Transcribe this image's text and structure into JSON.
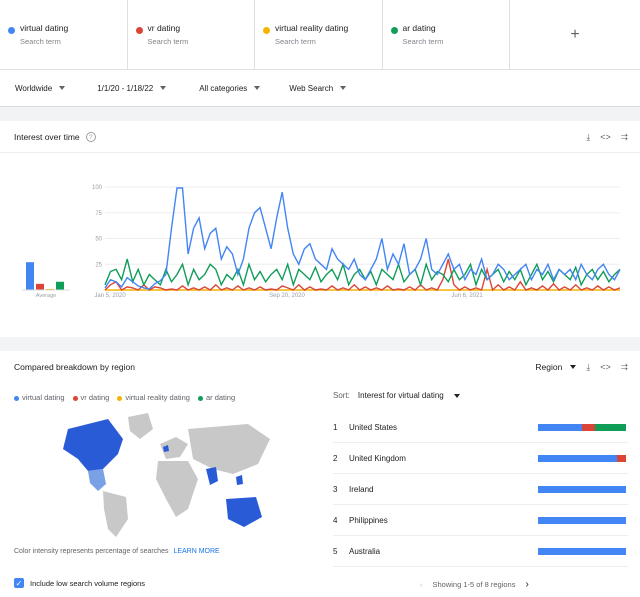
{
  "terms": [
    {
      "name": "virtual dating",
      "sub": "Search term",
      "color": "#4285f4"
    },
    {
      "name": "vr dating",
      "sub": "Search term",
      "color": "#db4437"
    },
    {
      "name": "virtual reality dating",
      "sub": "Search term",
      "color": "#f4b400"
    },
    {
      "name": "ar dating",
      "sub": "Search term",
      "color": "#0f9d58"
    }
  ],
  "add_icon": "+",
  "filters": {
    "region": "Worldwide",
    "dates": "1/1/20 - 1/18/22",
    "category": "All categories",
    "property": "Web Search"
  },
  "interest_card": {
    "title": "Interest over time",
    "help": "?",
    "icons": [
      "download-icon",
      "embed-icon",
      "share-icon"
    ]
  },
  "breakdown_card": {
    "title": "Compared breakdown by region",
    "region_select": "Region",
    "sort_label": "Sort:",
    "sort_value": "Interest for virtual dating",
    "note": "Color intensity represents percentage of searches",
    "learn_more": "LEARN MORE",
    "checkbox_label": "Include low search volume regions",
    "pagination": "Showing 1-5 of 8 regions"
  },
  "regions": [
    {
      "rank": "1",
      "name": "United States",
      "shares": [
        0.5,
        0.15,
        0.0,
        0.35
      ]
    },
    {
      "rank": "2",
      "name": "United Kingdom",
      "shares": [
        0.9,
        0.1,
        0.0,
        0.0
      ]
    },
    {
      "rank": "3",
      "name": "Ireland",
      "shares": [
        1.0,
        0.0,
        0.0,
        0.0
      ]
    },
    {
      "rank": "4",
      "name": "Philippines",
      "shares": [
        1.0,
        0.0,
        0.0,
        0.0
      ]
    },
    {
      "rank": "5",
      "name": "Australia",
      "shares": [
        1.0,
        0.0,
        0.0,
        0.0
      ]
    }
  ],
  "chart_data": {
    "type": "line",
    "yticks": [
      "100",
      "75",
      "50",
      "25"
    ],
    "ylim": [
      0,
      100
    ],
    "xtick_labels": [
      "Jan 5, 2020",
      "Sep 20, 2020",
      "Jun 6, 2021"
    ],
    "average_label": "Average",
    "averages": [
      27,
      6,
      1,
      8
    ],
    "colors": [
      "#4285f4",
      "#db4437",
      "#f4b400",
      "#0f9d58"
    ],
    "series": [
      {
        "name": "virtual dating",
        "values": [
          2,
          10,
          8,
          3,
          12,
          8,
          4,
          2,
          1,
          6,
          9,
          15,
          60,
          99,
          99,
          35,
          60,
          70,
          40,
          55,
          60,
          30,
          42,
          35,
          15,
          30,
          60,
          75,
          80,
          60,
          40,
          70,
          95,
          60,
          35,
          25,
          40,
          45,
          30,
          25,
          20,
          40,
          30,
          25,
          20,
          30,
          15,
          10,
          20,
          30,
          50,
          20,
          35,
          25,
          45,
          15,
          20,
          30,
          50,
          20,
          15,
          25,
          35,
          20,
          25,
          10,
          20,
          15,
          30,
          10,
          15,
          25,
          20,
          10,
          15,
          20,
          25,
          10,
          20,
          15,
          25,
          10,
          20,
          15,
          20,
          10,
          25,
          15,
          10,
          20,
          25,
          15,
          10,
          20
        ]
      },
      {
        "name": "vr dating",
        "values": [
          0,
          5,
          8,
          0,
          3,
          2,
          0,
          5,
          0,
          3,
          2,
          0,
          1,
          0,
          4,
          0,
          2,
          0,
          3,
          0,
          5,
          0,
          2,
          0,
          4,
          0,
          2,
          0,
          3,
          0,
          1,
          0,
          4,
          2,
          0,
          5,
          0,
          3,
          0,
          1,
          0,
          4,
          0,
          2,
          0,
          5,
          0,
          3,
          0,
          2,
          0,
          4,
          0,
          1,
          0,
          3,
          0,
          5,
          0,
          2,
          0,
          10,
          30,
          5,
          0,
          3,
          0,
          2,
          0,
          20,
          0,
          5,
          0,
          3,
          0,
          8,
          0,
          2,
          0,
          4,
          0,
          6,
          0,
          3,
          0,
          5,
          0,
          2,
          0,
          4,
          0,
          3,
          0,
          2
        ]
      },
      {
        "name": "virtual reality dating",
        "values": [
          0,
          0,
          0,
          0,
          0,
          0,
          0,
          0,
          0,
          0,
          0,
          0,
          0,
          0,
          0,
          0,
          0,
          0,
          0,
          0,
          0,
          0,
          0,
          0,
          0,
          0,
          0,
          0,
          0,
          0,
          0,
          0,
          0,
          0,
          0,
          0,
          0,
          0,
          0,
          0,
          0,
          0,
          0,
          0,
          0,
          0,
          0,
          0,
          0,
          0,
          0,
          0,
          0,
          0,
          0,
          0,
          0,
          0,
          0,
          0,
          0,
          0,
          0,
          0,
          0,
          0,
          0,
          0,
          0,
          0,
          0,
          0,
          0,
          0,
          0,
          0,
          0,
          0,
          0,
          0,
          0,
          0,
          0,
          0,
          0,
          0,
          0,
          0,
          0,
          0,
          0,
          0,
          0,
          0
        ]
      },
      {
        "name": "ar dating",
        "values": [
          5,
          18,
          20,
          10,
          30,
          8,
          20,
          5,
          15,
          10,
          5,
          20,
          8,
          15,
          25,
          5,
          20,
          10,
          15,
          25,
          20,
          5,
          15,
          10,
          20,
          5,
          25,
          10,
          18,
          8,
          15,
          20,
          10,
          25,
          5,
          20,
          15,
          10,
          22,
          8,
          15,
          20,
          10,
          25,
          5,
          15,
          20,
          10,
          18,
          5,
          20,
          15,
          10,
          25,
          8,
          15,
          20,
          5,
          25,
          10,
          18,
          15,
          8,
          20,
          10,
          15,
          25,
          5,
          20,
          10,
          15,
          20,
          8,
          18,
          10,
          20,
          5,
          15,
          25,
          10,
          18,
          8,
          20,
          15,
          10,
          22,
          5,
          15,
          20,
          10,
          18,
          8,
          15,
          20
        ]
      }
    ]
  }
}
